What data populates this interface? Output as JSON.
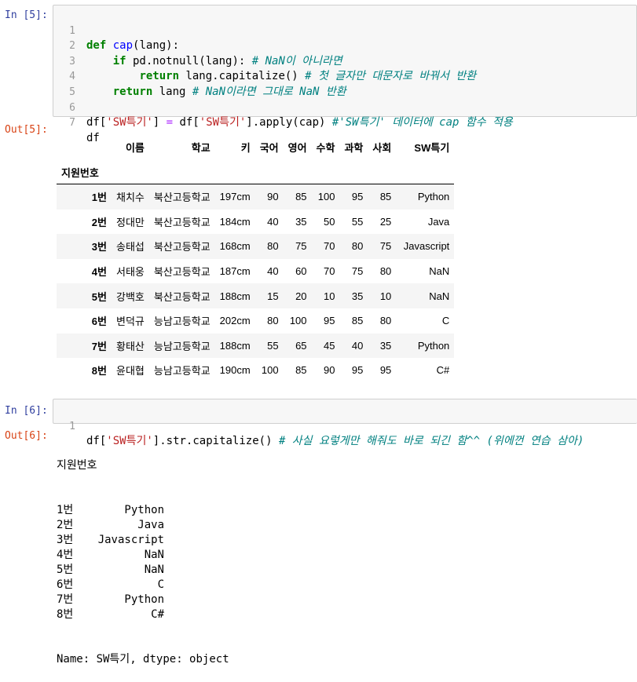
{
  "cell5": {
    "in_prompt": "In [5]:",
    "out_prompt": "Out[5]:",
    "line_numbers": [
      "1",
      "2",
      "3",
      "4",
      "5",
      "6",
      "7"
    ]
  },
  "dataframe": {
    "columns": [
      "이름",
      "학교",
      "키",
      "국어",
      "영어",
      "수학",
      "과학",
      "사회",
      "SW특기"
    ],
    "index_name": "지원번호",
    "rows": [
      {
        "index": "1번",
        "cells": [
          "채치수",
          "북산고등학교",
          "197cm",
          "90",
          "85",
          "100",
          "95",
          "85",
          "Python"
        ]
      },
      {
        "index": "2번",
        "cells": [
          "정대만",
          "북산고등학교",
          "184cm",
          "40",
          "35",
          "50",
          "55",
          "25",
          "Java"
        ]
      },
      {
        "index": "3번",
        "cells": [
          "송태섭",
          "북산고등학교",
          "168cm",
          "80",
          "75",
          "70",
          "80",
          "75",
          "Javascript"
        ]
      },
      {
        "index": "4번",
        "cells": [
          "서태웅",
          "북산고등학교",
          "187cm",
          "40",
          "60",
          "70",
          "75",
          "80",
          "NaN"
        ]
      },
      {
        "index": "5번",
        "cells": [
          "강백호",
          "북산고등학교",
          "188cm",
          "15",
          "20",
          "10",
          "35",
          "10",
          "NaN"
        ]
      },
      {
        "index": "6번",
        "cells": [
          "변덕규",
          "능남고등학교",
          "202cm",
          "80",
          "100",
          "95",
          "85",
          "80",
          "C"
        ]
      },
      {
        "index": "7번",
        "cells": [
          "황태산",
          "능남고등학교",
          "188cm",
          "55",
          "65",
          "45",
          "40",
          "35",
          "Python"
        ]
      },
      {
        "index": "8번",
        "cells": [
          "윤대협",
          "능남고등학교",
          "190cm",
          "100",
          "85",
          "90",
          "95",
          "95",
          "C#"
        ]
      }
    ]
  },
  "cell6": {
    "in_prompt": "In [6]:",
    "out_prompt": "Out[6]:",
    "line_number": "1"
  },
  "series_output": {
    "header": "지원번호",
    "rows": [
      {
        "index": "1번",
        "value": "Python"
      },
      {
        "index": "2번",
        "value": "Java"
      },
      {
        "index": "3번",
        "value": "Javascript"
      },
      {
        "index": "4번",
        "value": "NaN"
      },
      {
        "index": "5번",
        "value": "NaN"
      },
      {
        "index": "6번",
        "value": "C"
      },
      {
        "index": "7번",
        "value": "Python"
      },
      {
        "index": "8번",
        "value": "C#"
      }
    ],
    "footer": "Name: SW특기, dtype: object"
  }
}
